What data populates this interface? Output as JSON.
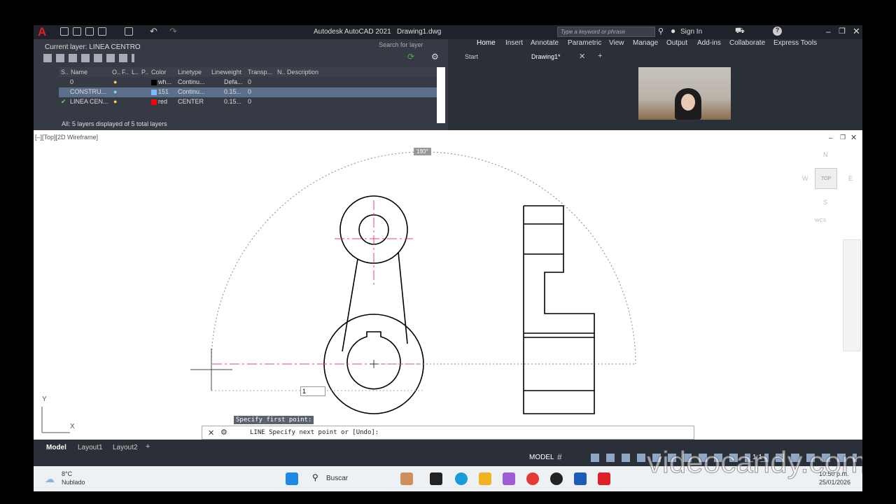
{
  "window": {
    "title": "Autodesk AutoCAD 2021",
    "doc": "Drawing1.dwg",
    "search_placeholder": "Type a keyword or phrase",
    "sign_in": "Sign In"
  },
  "ribbon": {
    "tabs": [
      "Home",
      "Insert",
      "Annotate",
      "Parametric",
      "View",
      "Manage",
      "Output",
      "Add-ins",
      "Collaborate",
      "Express Tools"
    ]
  },
  "doc_tabs": {
    "start": "Start",
    "drawing": "Drawing1*"
  },
  "layers": {
    "current": "Current layer: LINEA CENTRO",
    "search": "Search for layer",
    "headers": [
      "S..",
      "Name",
      "O..",
      "F..",
      "L..",
      "P..",
      "Color",
      "Linetype",
      "Lineweight",
      "Transp...",
      "N..",
      "Description"
    ],
    "rows": [
      {
        "name": "0",
        "color": "wh...",
        "color_hex": "#000000",
        "linetype": "Continu...",
        "lineweight": "Defa...",
        "transp": "0"
      },
      {
        "name": "CONSTRU...",
        "color": "151",
        "color_hex": "#7fb7ff",
        "linetype": "Continu...",
        "lineweight": "0.15...",
        "transp": "0"
      },
      {
        "name": "LINEA CEN...",
        "color": "red",
        "color_hex": "#ff0000",
        "linetype": "CENTER",
        "lineweight": "0.15...",
        "transp": "0"
      }
    ],
    "footer": "All: 5 layers displayed of 5 total layers"
  },
  "viewport": {
    "label": "[–][Top][2D Wireframe]",
    "angle_tooltip": "180°",
    "prompt_tooltip": "Specify first point:",
    "input_value": "1"
  },
  "viewcube": {
    "n": "N",
    "s": "S",
    "e": "E",
    "w": "W",
    "top": "TOP",
    "wcs": "WCS"
  },
  "ucs": {
    "x": "X",
    "y": "Y"
  },
  "command": {
    "text": "LINE Specify next point or [Undo]:"
  },
  "status": {
    "tabs": [
      "Model",
      "Layout1",
      "Layout2"
    ],
    "model": "MODEL",
    "scale": "1:1"
  },
  "taskbar": {
    "weather_temp": "8°C",
    "weather_desc": "Nublado",
    "search": "Buscar",
    "time": "10:50 p.m.",
    "date": "25/01/2026"
  },
  "watermark": "videocandy.com"
}
